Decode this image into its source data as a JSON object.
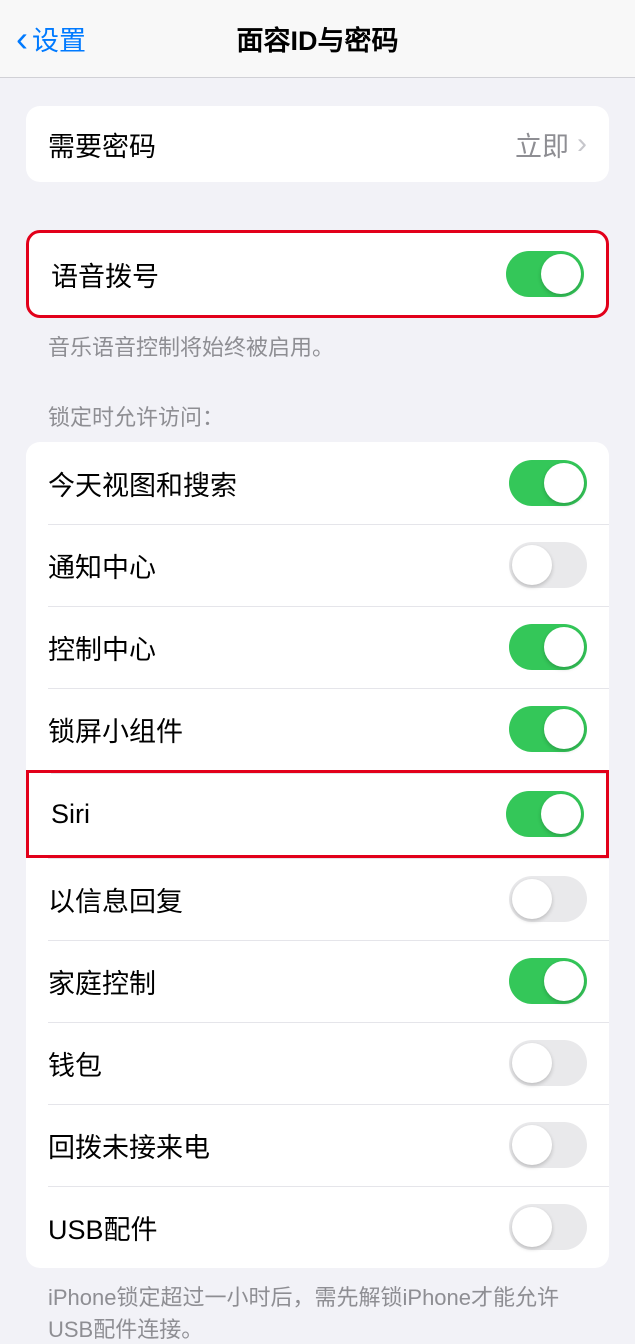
{
  "header": {
    "back_label": "设置",
    "title": "面容ID与密码"
  },
  "passcode_section": {
    "require_passcode": {
      "label": "需要密码",
      "value": "立即"
    }
  },
  "voice_section": {
    "voice_dial": {
      "label": "语音拨号",
      "on": true
    },
    "footer": "音乐语音控制将始终被启用。"
  },
  "lock_section": {
    "header": "锁定时允许访问：",
    "items": [
      {
        "label": "今天视图和搜索",
        "on": true
      },
      {
        "label": "通知中心",
        "on": false
      },
      {
        "label": "控制中心",
        "on": true
      },
      {
        "label": "锁屏小组件",
        "on": true
      },
      {
        "label": "Siri",
        "on": true
      },
      {
        "label": "以信息回复",
        "on": false
      },
      {
        "label": "家庭控制",
        "on": true
      },
      {
        "label": "钱包",
        "on": false
      },
      {
        "label": "回拨未接来电",
        "on": false
      },
      {
        "label": "USB配件",
        "on": false
      }
    ],
    "footer": "iPhone锁定超过一小时后，需先解锁iPhone才能允许USB配件连接。"
  }
}
